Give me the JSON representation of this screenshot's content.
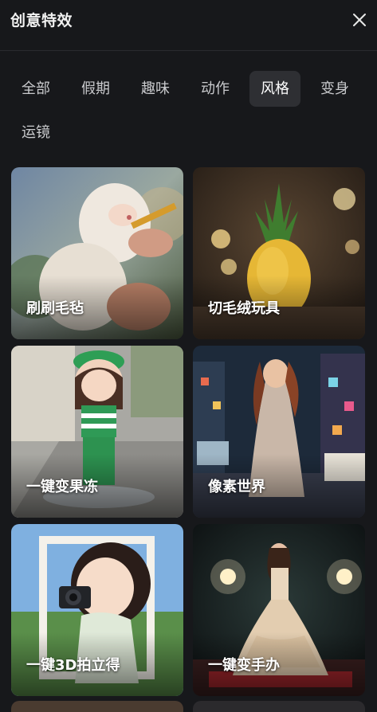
{
  "header": {
    "title": "创意特效",
    "close_icon": "close-icon"
  },
  "tabs": [
    {
      "label": "全部",
      "active": false
    },
    {
      "label": "假期",
      "active": false
    },
    {
      "label": "趣味",
      "active": false
    },
    {
      "label": "动作",
      "active": false
    },
    {
      "label": "风格",
      "active": true
    },
    {
      "label": "变身",
      "active": false
    },
    {
      "label": "运镜",
      "active": false
    }
  ],
  "effects": [
    {
      "label": "刷刷毛毡"
    },
    {
      "label": "切毛绒玩具"
    },
    {
      "label": "一键变果冻"
    },
    {
      "label": "像素世界"
    },
    {
      "label": "一键3D拍立得"
    },
    {
      "label": "一键变手办"
    }
  ],
  "colors": {
    "background": "#17181b",
    "active_tab": "#2e2f33",
    "tab_text": "#c9cacd"
  }
}
